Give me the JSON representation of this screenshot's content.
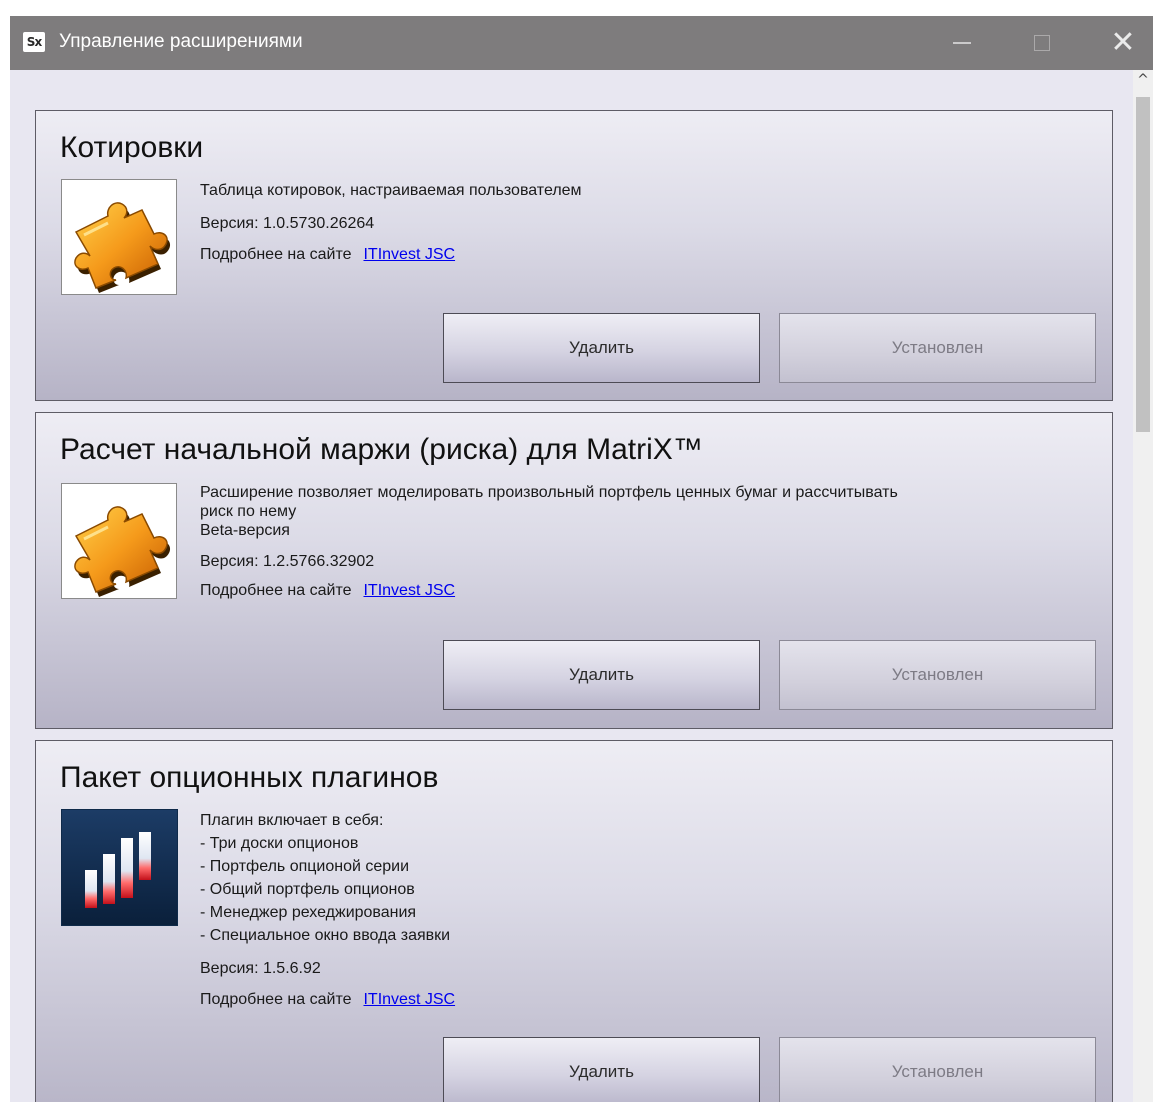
{
  "window": {
    "app_icon_text": "Sx",
    "title": "Управление расширениями",
    "controls": {
      "minimize": "—",
      "maximize": "□",
      "close": "✕"
    }
  },
  "extensions": [
    {
      "title": "Котировки",
      "icon": "puzzle-icon",
      "description_lines": [
        "Таблица котировок, настраиваемая пользователем"
      ],
      "version": "Версия: 1.0.5730.26264",
      "more_label": "Подробнее на сайте",
      "link": "ITInvest JSC",
      "remove_label": "Удалить",
      "status_label": "Установлен"
    },
    {
      "title": "Расчет начальной маржи (риска) для MatriX™",
      "icon": "puzzle-icon",
      "description_lines": [
        "Расширение позволяет моделировать произвольный портфель ценных бумаг и рассчитывать",
        "риск по нему",
        "Beta-версия"
      ],
      "version": "Версия: 1.2.5766.32902",
      "more_label": "Подробнее на сайте",
      "link": "ITInvest JSC",
      "remove_label": "Удалить",
      "status_label": "Установлен"
    },
    {
      "title": "Пакет опционных плагинов",
      "icon": "bar-chart-icon",
      "description_lines": [
        "Плагин включает в себя:",
        "- Три доски опционов",
        "- Портфель опционой серии",
        "- Общий портфель опционов",
        "- Менеджер рехеджирования",
        "- Специальное окно ввода заявки"
      ],
      "version": "Версия: 1.5.6.92",
      "more_label": "Подробнее на сайте",
      "link": "ITInvest JSC",
      "remove_label": "Удалить",
      "status_label": "Установлен"
    }
  ],
  "scrollbar": {
    "up_arrow": "^"
  }
}
